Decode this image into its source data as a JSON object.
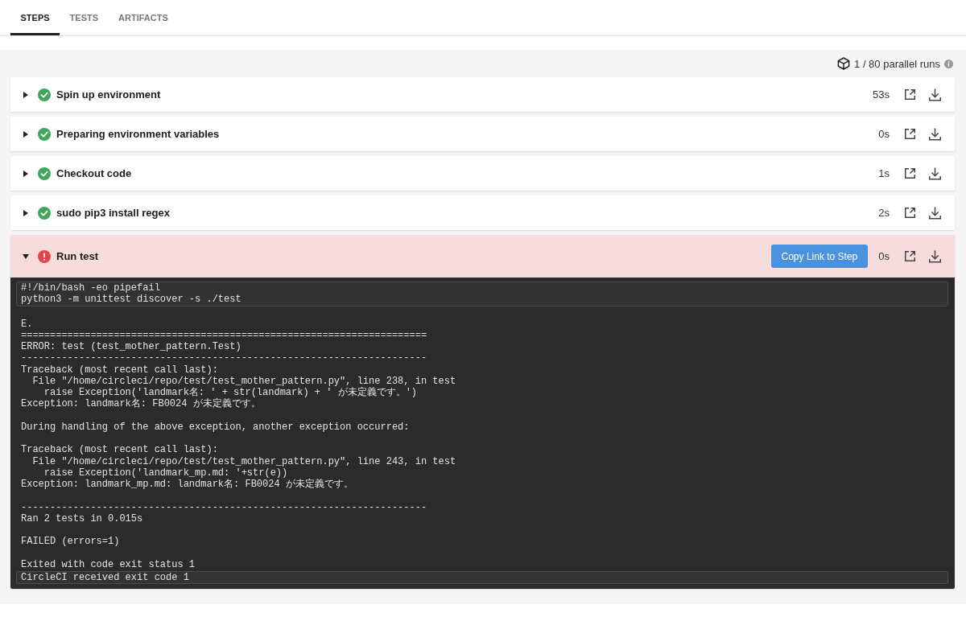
{
  "tabs": [
    {
      "label": "STEPS",
      "selected": true
    },
    {
      "label": "TESTS",
      "selected": false
    },
    {
      "label": "ARTIFACTS",
      "selected": false
    }
  ],
  "parallel_runs": "1 / 80 parallel runs",
  "steps": [
    {
      "title": "Spin up environment",
      "failed": false,
      "expanded": false,
      "duration": "53s"
    },
    {
      "title": "Preparing environment variables",
      "failed": false,
      "expanded": false,
      "duration": "0s"
    },
    {
      "title": "Checkout code",
      "failed": false,
      "expanded": false,
      "duration": "1s"
    },
    {
      "title": "sudo pip3 install regex",
      "failed": false,
      "expanded": false,
      "duration": "2s"
    },
    {
      "title": "Run test",
      "failed": true,
      "expanded": true,
      "copy_link_button": "Copy Link to Step",
      "duration": "0s",
      "log": {
        "command": [
          "#!/bin/bash -eo pipefail",
          "python3 -m unittest discover -s ./test"
        ],
        "output_blocks": [
          [
            "E.",
            "======================================================================",
            "ERROR: test (test_mother_pattern.Test)",
            "----------------------------------------------------------------------",
            "Traceback (most recent call last):",
            "  File \"/home/circleci/repo/test/test_mother_pattern.py\", line 238, in test",
            "    raise Exception('landmark名: ' + str(landmark) + ' が未定義です。')",
            "Exception: landmark名: FB0024 が未定義です。"
          ],
          [
            "During handling of the above exception, another exception occurred:"
          ],
          [
            "Traceback (most recent call last):",
            "  File \"/home/circleci/repo/test/test_mother_pattern.py\", line 243, in test",
            "    raise Exception('landmark_mp.md: '+str(e))",
            "Exception: landmark_mp.md: landmark名: FB0024 が未定義です。"
          ],
          [
            "----------------------------------------------------------------------",
            "Ran 2 tests in 0.015s"
          ],
          [
            "FAILED (errors=1)"
          ],
          [
            "Exited with code exit status 1"
          ]
        ],
        "exit_message": "CircleCI received exit code 1"
      }
    }
  ]
}
